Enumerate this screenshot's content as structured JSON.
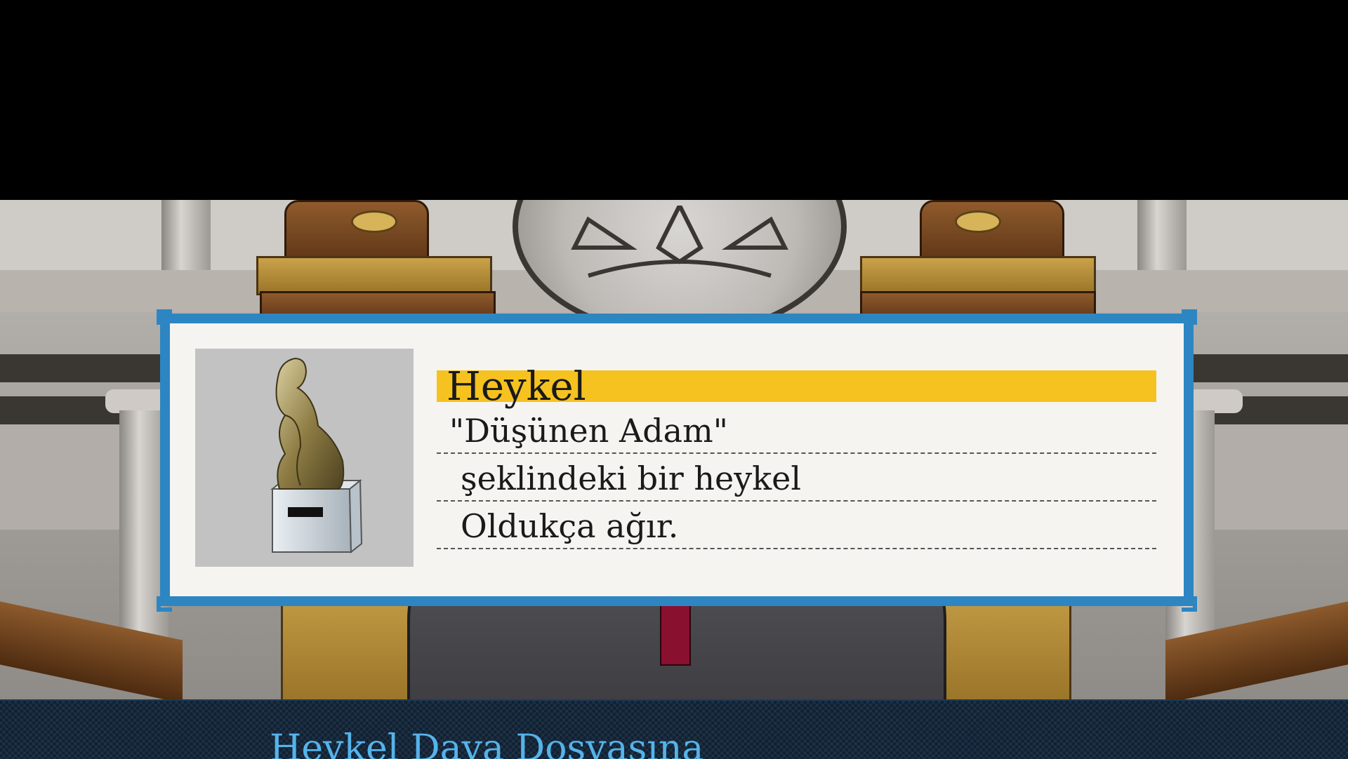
{
  "evidence": {
    "name": "Heykel",
    "description": [
      "\"Düşünen Adam\"",
      "şeklindeki bir heykel",
      "Oldukça ağır."
    ],
    "image_icon": "thinker-statue-icon",
    "name_bar_color": "#f5c220",
    "frame_color": "#2d86c2"
  },
  "message": {
    "text": "Heykel Dava Dosyasına",
    "color": "#55b3ea"
  }
}
